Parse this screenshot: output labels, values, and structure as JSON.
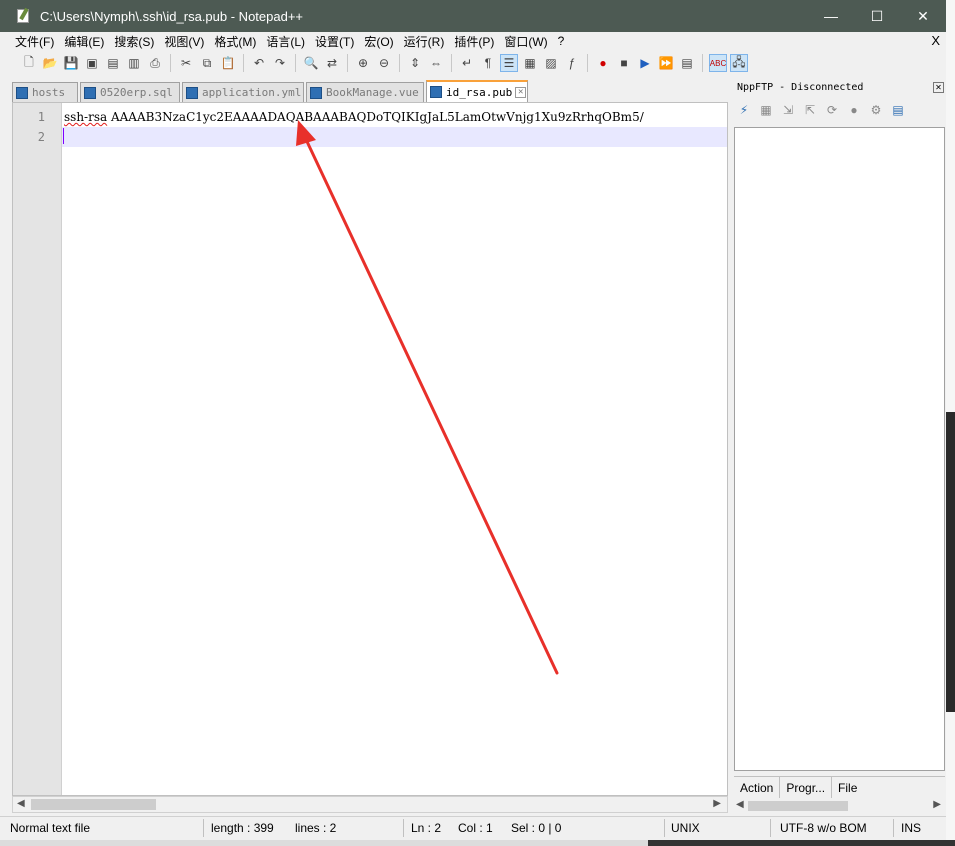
{
  "window": {
    "title": "C:\\Users\\Nymph\\.ssh\\id_rsa.pub - Notepad++",
    "minimize_glyph": "—",
    "maximize_glyph": "☐",
    "close_glyph": "✕"
  },
  "menu": {
    "items": [
      "文件(F)",
      "编辑(E)",
      "搜索(S)",
      "视图(V)",
      "格式(M)",
      "语言(L)",
      "设置(T)",
      "宏(O)",
      "运行(R)",
      "插件(P)",
      "窗口(W)",
      "?"
    ],
    "close_glyph": "X"
  },
  "tabs": [
    {
      "label": "hosts",
      "active": false
    },
    {
      "label": "0520erp.sql",
      "active": false
    },
    {
      "label": "application.yml",
      "active": false
    },
    {
      "label": "BookManage.vue",
      "active": false
    },
    {
      "label": "id_rsa.pub",
      "active": true
    }
  ],
  "editor": {
    "line_numbers": [
      "1",
      "2"
    ],
    "line1_keyword": "ssh-rsa",
    "line1_rest": " AAAAB3NzaC1yc2EAAAADAQABAAABAQDoTQIKIgJaL5LamOtwVnjg1Xu9zRrhqOBm5/",
    "line2": ""
  },
  "ftp": {
    "title": "NppFTP - Disconnected",
    "tabs": [
      "Action",
      "Progr...",
      "File"
    ]
  },
  "status": {
    "file_type": "Normal text file",
    "length": "length : 399",
    "lines": "lines : 2",
    "ln": "Ln : 2",
    "col": "Col : 1",
    "sel": "Sel : 0 | 0",
    "eol": "UNIX",
    "encoding": "UTF-8 w/o BOM",
    "mode": "INS"
  },
  "annotation": {
    "arrow_color": "#e8302a"
  }
}
